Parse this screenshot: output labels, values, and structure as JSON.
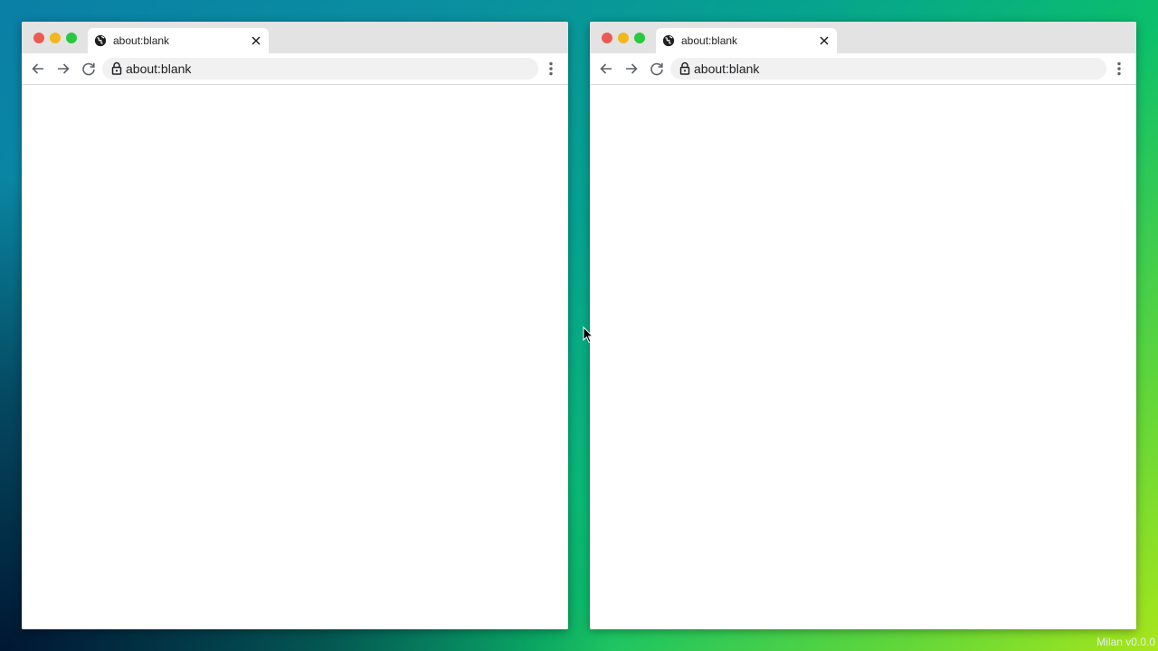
{
  "colors": {
    "traffic_close": "#ec5b52",
    "traffic_minimize": "#f2b71c",
    "traffic_maximize": "#27c93f",
    "titlebar": "#e3e3e3",
    "omnibox": "#f1f1f1"
  },
  "icons": {
    "favicon": "globe-icon",
    "tab_close": "close-icon",
    "back": "arrow-left-icon",
    "forward": "arrow-right-icon",
    "reload": "reload-icon",
    "security": "lock-icon",
    "menu": "kebab-menu-icon",
    "pointer": "mouse-pointer-icon"
  },
  "windows": [
    {
      "tab_title": "about:blank",
      "address": "about:blank"
    },
    {
      "tab_title": "about:blank",
      "address": "about:blank"
    }
  ],
  "footer": {
    "version": "Milan v0.0.0"
  }
}
